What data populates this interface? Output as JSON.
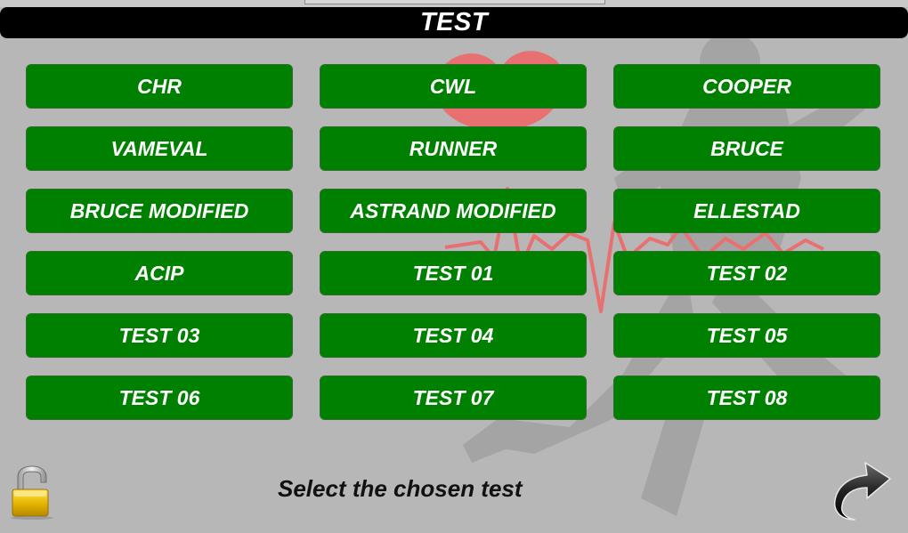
{
  "header": {
    "title": "TEST"
  },
  "tests": [
    {
      "label": "CHR"
    },
    {
      "label": "CWL"
    },
    {
      "label": "COOPER"
    },
    {
      "label": "VAMEVAL"
    },
    {
      "label": "RUNNER"
    },
    {
      "label": "BRUCE"
    },
    {
      "label": "BRUCE MODIFIED"
    },
    {
      "label": "ASTRAND MODIFIED"
    },
    {
      "label": "ELLESTAD"
    },
    {
      "label": "ACIP"
    },
    {
      "label": "TEST 01"
    },
    {
      "label": "TEST 02"
    },
    {
      "label": "TEST 03"
    },
    {
      "label": "TEST 04"
    },
    {
      "label": "TEST 05"
    },
    {
      "label": "TEST 06"
    },
    {
      "label": "TEST 07"
    },
    {
      "label": "TEST 08"
    }
  ],
  "footer": {
    "status": "Select the chosen test",
    "lock_icon": "unlocked-padlock-icon",
    "next_icon": "curved-arrow-right-icon"
  },
  "colors": {
    "button": "#008000",
    "title_bar": "#000000",
    "background": "#b7b7b7",
    "heart": "#e86a6a"
  }
}
